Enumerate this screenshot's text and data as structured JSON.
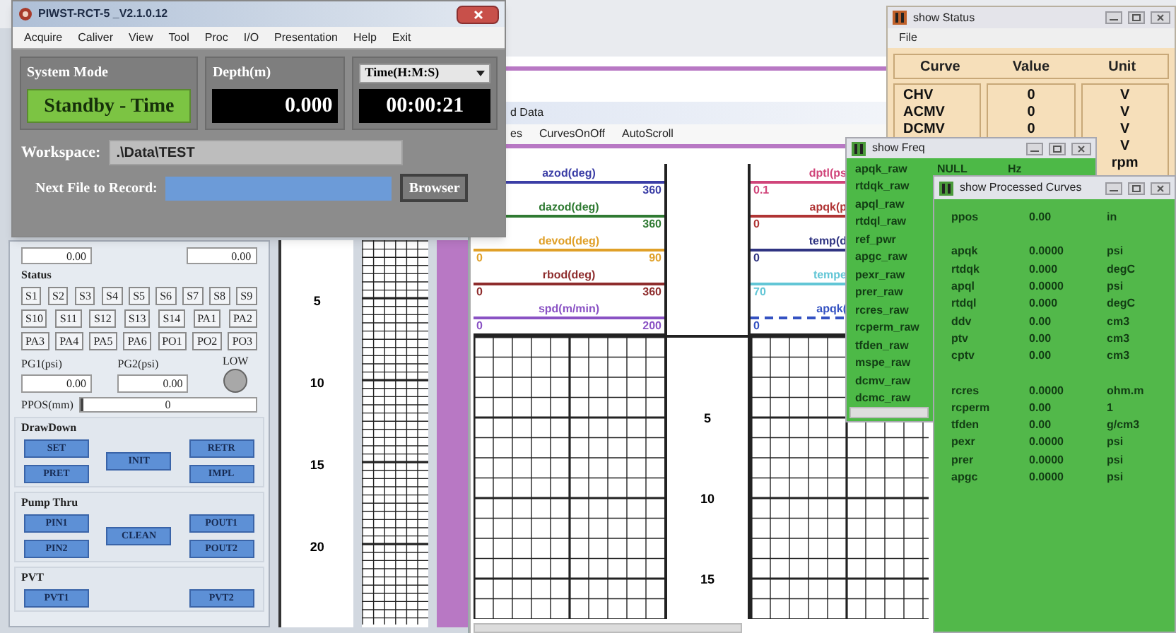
{
  "main_window": {
    "title": "PIWST-RCT-5 _V2.1.0.12",
    "menu": [
      "Acquire",
      "Caliver",
      "View",
      "Tool",
      "Proc",
      "I/O",
      "Presentation",
      "Help",
      "Exit"
    ],
    "system_mode": {
      "label": "System Mode",
      "value": "Standby - Time"
    },
    "depth": {
      "label": "Depth(m)",
      "value": "0.000"
    },
    "time": {
      "selector": "Time(H:M:S)",
      "value": "00:00:21"
    },
    "workspace": {
      "label": "Workspace:",
      "value": ".\\Data\\TEST"
    },
    "next_file": {
      "label": "Next File to Record:",
      "button": "Browser"
    }
  },
  "control_panel": {
    "top_values": [
      "0.00",
      "0.00"
    ],
    "status": {
      "title": "Status",
      "buttons": [
        [
          "S1",
          "S2",
          "S3",
          "S4",
          "S5",
          "S6",
          "S7",
          "S8",
          "S9"
        ],
        [
          "S10",
          "S11",
          "S12",
          "S13",
          "S14",
          "PA1",
          "PA2"
        ],
        [
          "PA3",
          "PA4",
          "PA5",
          "PA6",
          "PO1",
          "PO2",
          "PO3"
        ]
      ]
    },
    "pg1": {
      "label": "PG1(psi)",
      "value": "0.00"
    },
    "pg2": {
      "label": "PG2(psi)",
      "value": "0.00"
    },
    "low": {
      "label": "LOW",
      "on": false
    },
    "ppos": {
      "label": "PPOS(mm)",
      "value": "0",
      "level": 0.02
    },
    "groups": [
      {
        "title": "DrawDown",
        "left": [
          "SET",
          "PRET"
        ],
        "center": [
          "INIT"
        ],
        "right": [
          "RETR",
          "IMPL"
        ]
      },
      {
        "title": "Pump Thru",
        "left": [
          "PIN1",
          "PIN2"
        ],
        "center": [
          "CLEAN"
        ],
        "right": [
          "POUT1",
          "POUT2"
        ]
      },
      {
        "title": "PVT",
        "left": [
          "PVT1"
        ],
        "right": [
          "PVT2"
        ]
      }
    ]
  },
  "depth_track": {
    "labels": [
      "5",
      "10",
      "15",
      "20"
    ]
  },
  "log_window": {
    "title": "d Data",
    "menu": [
      "es",
      "CurvesOnOff",
      "AutoScroll"
    ],
    "left_track_curves": [
      {
        "name": "azod(deg)",
        "color": "#3b3ea6",
        "max": "360",
        "dashed": false
      },
      {
        "name": "dazod(deg)",
        "color": "#2f7a32",
        "max": "360",
        "dashed": false
      },
      {
        "name": "devod(deg)",
        "color": "#e0a028",
        "min": "0",
        "max": "90",
        "dashed": false
      },
      {
        "name": "rbod(deg)",
        "color": "#8e2c2c",
        "min": "0",
        "max": "360",
        "dashed": false
      },
      {
        "name": "spd(m/min)",
        "color": "#8a52c4",
        "min": "0",
        "max": "200",
        "dashed": false
      }
    ],
    "depth_labels": [
      "5",
      "10",
      "15"
    ],
    "right_track_curves": [
      {
        "name": "dptl(ps",
        "color": "#d0457a",
        "min": "0.1",
        "dashed": false
      },
      {
        "name": "apqk(p",
        "color": "#b03434",
        "min": "0",
        "dashed": false
      },
      {
        "name": "temp(d",
        "color": "#303482",
        "min": "0",
        "dashed": false
      },
      {
        "name": "tempe",
        "color": "#62c6d6",
        "min": "70",
        "dashed": false
      },
      {
        "name": "apqk(",
        "color": "#3452c2",
        "min": "0",
        "dashed": true
      }
    ]
  },
  "status_window": {
    "title": "show Status",
    "menu": [
      "File"
    ],
    "columns": [
      "Curve",
      "Value",
      "Unit"
    ],
    "rows": [
      {
        "curve": "CHV",
        "value": "0",
        "unit": "V"
      },
      {
        "curve": "ACMV",
        "value": "0",
        "unit": "V"
      },
      {
        "curve": "DCMV",
        "value": "0",
        "unit": "V"
      },
      {
        "unit": "V"
      },
      {
        "unit": "rpm"
      }
    ]
  },
  "freq_window": {
    "title": "show Freq",
    "rows": [
      {
        "name": "apqk_raw",
        "value": "NULL",
        "unit": "Hz"
      },
      {
        "name": "rtdqk_raw"
      },
      {
        "name": "apql_raw"
      },
      {
        "name": "rtdql_raw"
      },
      {
        "name": "ref_pwr"
      },
      {
        "name": "apgc_raw"
      },
      {
        "name": "pexr_raw"
      },
      {
        "name": "prer_raw"
      },
      {
        "name": "rcres_raw"
      },
      {
        "name": "rcperm_raw"
      },
      {
        "name": "tfden_raw"
      },
      {
        "name": "mspe_raw"
      },
      {
        "name": "dcmv_raw"
      },
      {
        "name": "dcmc_raw"
      }
    ]
  },
  "processed_window": {
    "title": "show Processed Curves",
    "groups": [
      {
        "rows": [
          {
            "name": "ppos",
            "value": "0.00",
            "unit": "in"
          }
        ]
      },
      {
        "rows": [
          {
            "name": "apqk",
            "value": "0.0000",
            "unit": "psi"
          },
          {
            "name": "rtdqk",
            "value": "0.000",
            "unit": "degC"
          },
          {
            "name": "apql",
            "value": "0.0000",
            "unit": "psi"
          },
          {
            "name": "rtdql",
            "value": "0.000",
            "unit": "degC"
          },
          {
            "name": "ddv",
            "value": "0.00",
            "unit": "cm3"
          },
          {
            "name": "ptv",
            "value": "0.00",
            "unit": "cm3"
          },
          {
            "name": "cptv",
            "value": "0.00",
            "unit": "cm3"
          }
        ]
      },
      {
        "rows": [
          {
            "name": "rcres",
            "value": "0.0000",
            "unit": "ohm.m"
          },
          {
            "name": "rcperm",
            "value": "0.00",
            "unit": "1"
          },
          {
            "name": "tfden",
            "value": "0.00",
            "unit": "g/cm3"
          },
          {
            "name": "pexr",
            "value": "0.0000",
            "unit": "psi"
          },
          {
            "name": "prer",
            "value": "0.0000",
            "unit": "psi"
          },
          {
            "name": "apgc",
            "value": "0.0000",
            "unit": "psi"
          }
        ]
      }
    ]
  }
}
